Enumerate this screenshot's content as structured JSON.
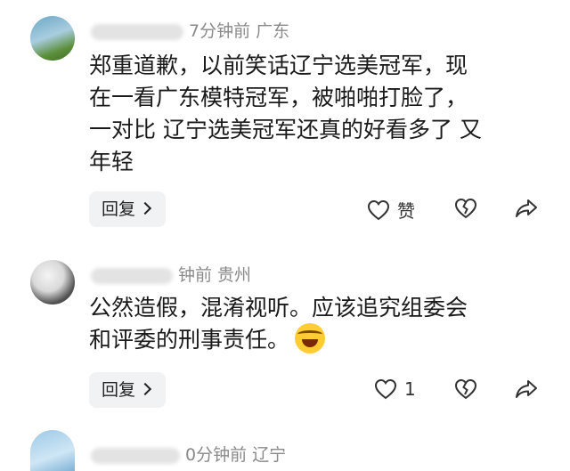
{
  "comments": [
    {
      "meta": "7分钟前  广东",
      "body_lines": [
        "郑重道歉，以前笑话辽宁选美冠军，现",
        "在一看广东模特冠军，被啪啪打脸了，",
        "一对比 辽宁选美冠军还真的好看多了 又",
        "年轻"
      ],
      "reply_label": "回复",
      "like_label": "赞"
    },
    {
      "meta": "钟前  贵州",
      "body_lines": [
        "公然造假，混淆视听。应该追究组委会",
        "和评委的刑事责任。"
      ],
      "reply_label": "回复",
      "like_count": "1"
    },
    {
      "meta": "0分钟前  辽宁"
    }
  ],
  "colors": {
    "meta_text": "#8a8a8a",
    "reply_bg": "#f1f2f4"
  },
  "icons": [
    "heart-icon",
    "broken-heart-icon",
    "share-icon",
    "chevron-right-icon",
    "laughing-crying-emoji"
  ]
}
